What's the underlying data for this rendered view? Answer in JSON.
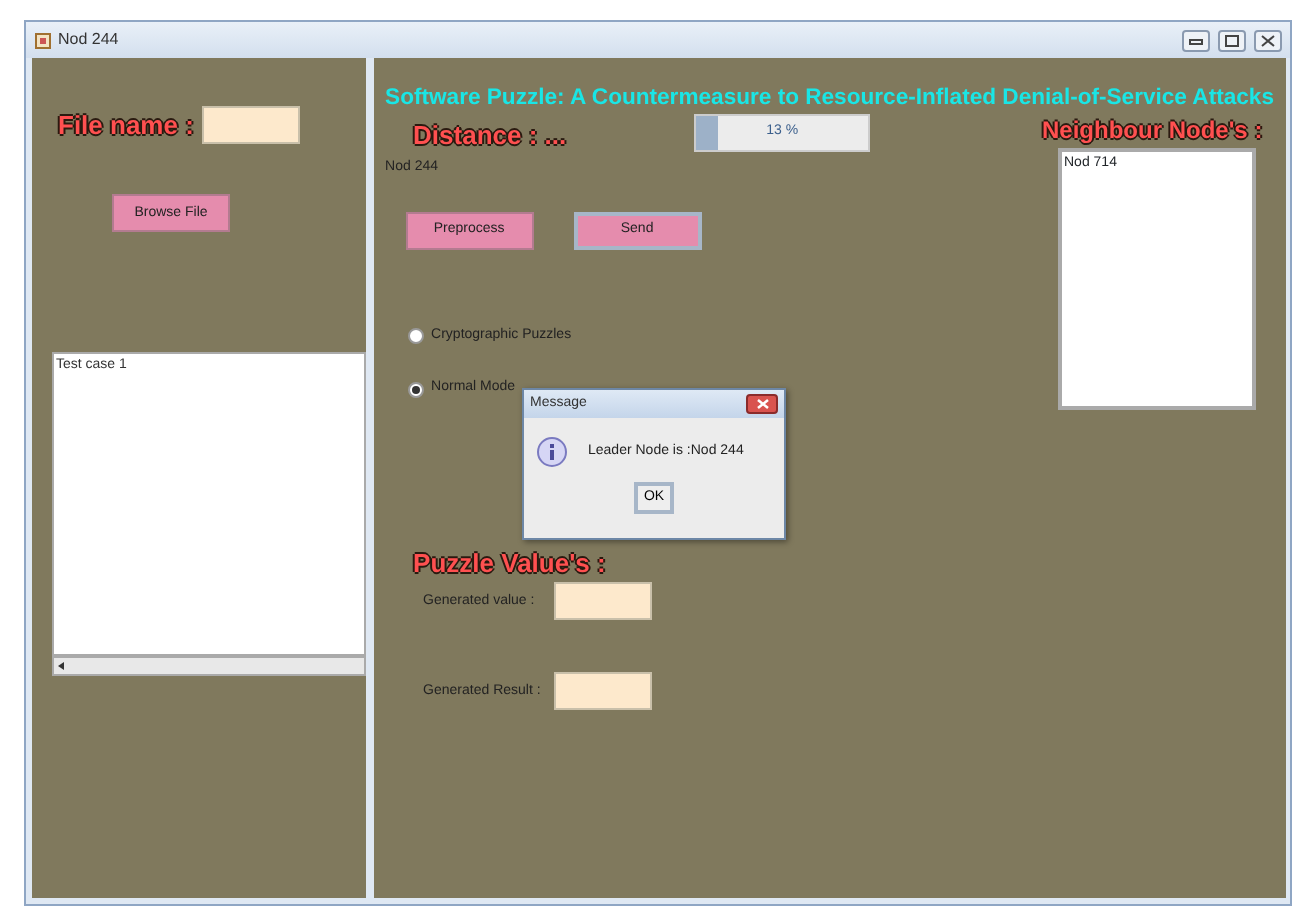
{
  "window": {
    "title": "Nod 244"
  },
  "left_panel": {
    "file_name_label": "File name :",
    "browse_button": "Browse File",
    "text_area": "Test case 1"
  },
  "right_panel": {
    "heading": "Software Puzzle: A Countermeasure to Resource-Inflated Denial-of-Service Attacks",
    "distance_label": "Distance : ...",
    "progress": {
      "level": 0.13,
      "reading": "13 %"
    },
    "node_label": "Nod 244",
    "buttons": [
      {
        "label": "Preprocess",
        "focused": false
      },
      {
        "label": "Send",
        "focused": true
      }
    ],
    "modes": [
      {
        "label": "Cryptographic Puzzles",
        "selected": false
      },
      {
        "label": "Normal Mode",
        "selected": true
      }
    ],
    "puzzle_label": "Puzzle Value's :",
    "fields": [
      {
        "label": "Generated value :"
      },
      {
        "label": "Generated Result :"
      }
    ],
    "neighbours_label": "Neighbour Node's :",
    "neighbours": [
      "Nod 714"
    ]
  },
  "dialog": {
    "title": "Message",
    "message": "Leader Node is :Nod 244",
    "button": "OK"
  }
}
